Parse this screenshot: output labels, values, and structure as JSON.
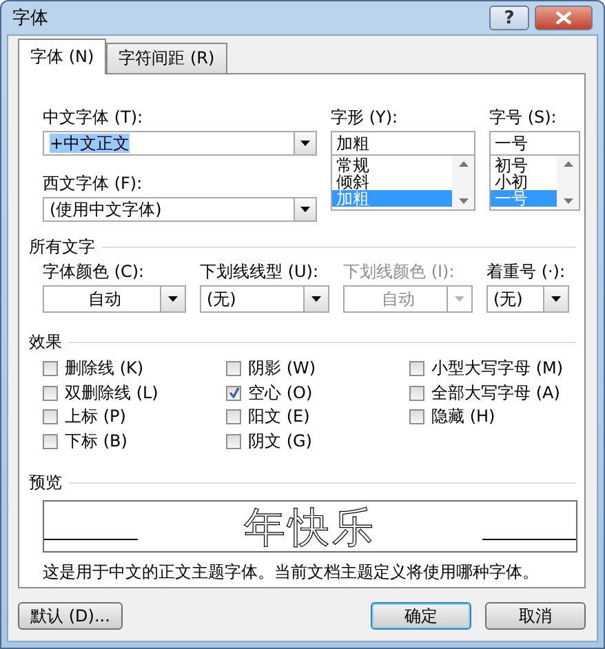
{
  "window": {
    "title": "字体",
    "help_button": "?"
  },
  "tabs": [
    {
      "label": "字体 (N)",
      "selected": true
    },
    {
      "label": "字符间距 (R)",
      "selected": false
    }
  ],
  "chinese_font": {
    "label": "中文字体 (T):",
    "value": "+中文正文",
    "text_selected": true
  },
  "western_font": {
    "label": "西文字体 (F):",
    "value": "(使用中文字体)"
  },
  "font_style": {
    "label": "字形 (Y):",
    "value": "加粗",
    "options": [
      {
        "label": "常规",
        "selected": false
      },
      {
        "label": "倾斜",
        "selected": false
      },
      {
        "label": "加粗",
        "selected": true
      }
    ]
  },
  "font_size": {
    "label": "字号 (S):",
    "value": "一号",
    "options": [
      {
        "label": "初号",
        "selected": false
      },
      {
        "label": "小初",
        "selected": false
      },
      {
        "label": "一号",
        "selected": true
      }
    ]
  },
  "all_text": {
    "heading": "所有文字",
    "dropdowns": [
      {
        "label": "字体颜色 (C):",
        "value": "自动",
        "disabled": false,
        "centered": true
      },
      {
        "label": "下划线线型 (U):",
        "value": "(无)",
        "disabled": false,
        "centered": false
      },
      {
        "label": "下划线颜色 (I):",
        "value": "自动",
        "disabled": true,
        "centered": true
      },
      {
        "label": "着重号 (·):",
        "value": "(无)",
        "disabled": false,
        "centered": false
      }
    ]
  },
  "effects": {
    "heading": "效果",
    "checkboxes": [
      {
        "label": "删除线 (K)",
        "checked": false
      },
      {
        "label": "双删除线 (L)",
        "checked": false
      },
      {
        "label": "上标 (P)",
        "checked": false
      },
      {
        "label": "下标 (B)",
        "checked": false
      },
      {
        "label": "阴影 (W)",
        "checked": false
      },
      {
        "label": "空心 (O)",
        "checked": true
      },
      {
        "label": "阳文 (E)",
        "checked": false
      },
      {
        "label": "阴文 (G)",
        "checked": false
      },
      {
        "label": "小型大写字母 (M)",
        "checked": false
      },
      {
        "label": "全部大写字母 (A)",
        "checked": false
      },
      {
        "label": "隐藏 (H)",
        "checked": false
      }
    ]
  },
  "preview": {
    "heading": "预览",
    "sample": "年快乐",
    "outline": true,
    "description": "这是用于中文的正文主题字体。当前文档主题定义将使用哪种字体。"
  },
  "buttons": [
    {
      "label": "默认 (D)...",
      "focused": false
    },
    {
      "label": "确定",
      "focused": true
    },
    {
      "label": "取消",
      "focused": false
    }
  ]
}
